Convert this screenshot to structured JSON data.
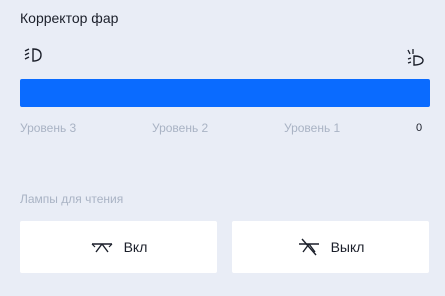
{
  "headlight": {
    "title": "Корректор фар",
    "icons": {
      "low": "headlight-low-icon",
      "high": "headlight-high-icon"
    },
    "levels": [
      "Уровень 3",
      "Уровень 2",
      "Уровень 1",
      "0"
    ],
    "level_fill": 1.0,
    "accent_color": "#0a6bff"
  },
  "reading_lamps": {
    "label": "Лампы для чтения",
    "on_label": "Вкл",
    "off_label": "Выкл",
    "icons": {
      "on": "reading-lamp-on-icon",
      "off": "reading-lamp-off-icon"
    }
  }
}
